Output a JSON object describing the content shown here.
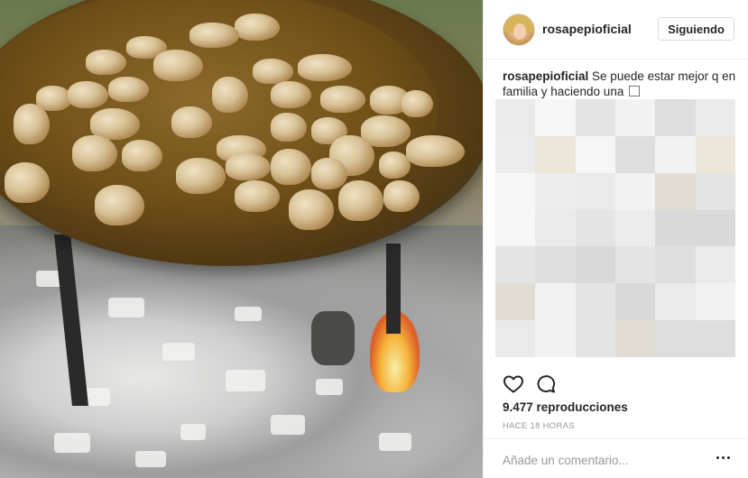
{
  "post": {
    "username": "rosapepioficial",
    "follow_label": "Siguiendo",
    "caption_username": "rosapepioficial",
    "caption_text": "Se puede estar mejor q en familia y haciendo una",
    "views": "9.477 reproducciones",
    "timestamp": "HACE 18 HORAS",
    "comment_placeholder": "Añade un comentario..."
  },
  "icons": {
    "like": "heart-icon",
    "comment": "comment-bubble-icon",
    "more": "more-options-icon"
  },
  "colors": {
    "text": "#262626",
    "muted": "#999999",
    "border": "#dbdbdb",
    "divider": "#efefef"
  }
}
